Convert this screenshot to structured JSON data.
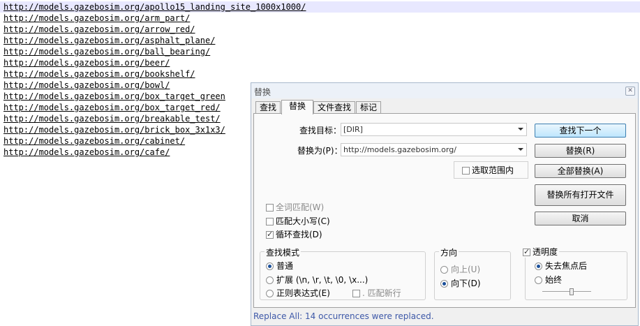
{
  "editor": {
    "lines": [
      "http://models.gazebosim.org/apollo15_landing_site_1000x1000/",
      "http://models.gazebosim.org/arm_part/",
      "http://models.gazebosim.org/arrow_red/",
      "http://models.gazebosim.org/asphalt_plane/",
      "http://models.gazebosim.org/ball_bearing/",
      "http://models.gazebosim.org/beer/",
      "http://models.gazebosim.org/bookshelf/",
      "http://models.gazebosim.org/bowl/",
      "http://models.gazebosim.org/box_target_green",
      "http://models.gazebosim.org/box_target_red/",
      "http://models.gazebosim.org/breakable_test/",
      "http://models.gazebosim.org/brick_box_3x1x3/",
      "http://models.gazebosim.org/cabinet/",
      "http://models.gazebosim.org/cafe/"
    ]
  },
  "dialog": {
    "title": "替换",
    "tabs": [
      "查找",
      "替换",
      "文件查找",
      "标记"
    ],
    "active_tab": "替换",
    "find_label": "查找目标：",
    "find_value": "[DIR]",
    "replace_label": "替换为(P)：",
    "replace_value": "http://models.gazebosim.org/",
    "in_selection": "选取范围内",
    "buttons": {
      "find_next": "查找下一个",
      "replace": "替换(R)",
      "replace_all": "全部替换(A)",
      "replace_all_open": "替换所有打开文件",
      "cancel": "取消"
    },
    "options": {
      "whole_word": "全词匹配(W)",
      "match_case": "匹配大小写(C)",
      "wrap_around": "循环查找(D)"
    },
    "search_mode": {
      "title": "查找模式",
      "normal": "普通",
      "extended": "扩展 (\\n, \\r, \\t, \\0, \\x...)",
      "regex": "正则表达式(E)",
      "dot_newline": ". 匹配新行"
    },
    "direction": {
      "title": "方向",
      "up": "向上(U)",
      "down": "向下(D)"
    },
    "transparency": {
      "title": "透明度",
      "on_lose_focus": "失去焦点后",
      "always": "始终",
      "level": 0.6
    },
    "status": "Replace All: 14 occurrences were replaced."
  }
}
